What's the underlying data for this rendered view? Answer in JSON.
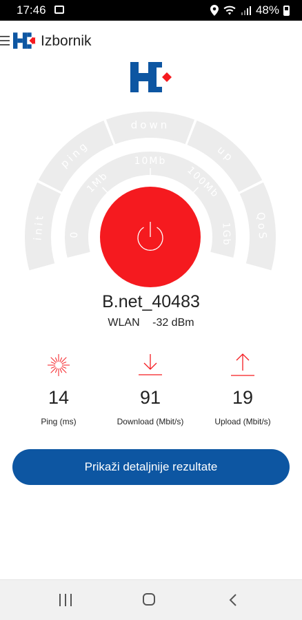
{
  "status_bar": {
    "time": "17:46",
    "battery": "48%"
  },
  "header": {
    "title": "Izbornik"
  },
  "gauge": {
    "outer_labels": [
      "init",
      "ping",
      "down",
      "up",
      "QoS"
    ],
    "inner_labels": [
      "0",
      "1Mb",
      "10Mb",
      "100Mb",
      "1Gb"
    ]
  },
  "network": {
    "name": "B.net_40483",
    "type": "WLAN",
    "signal": "-32 dBm"
  },
  "results": {
    "ping": {
      "value": "14",
      "label": "Ping  (ms)"
    },
    "download": {
      "value": "91",
      "label": "Download  (Mbit/s)"
    },
    "upload": {
      "value": "19",
      "label": "Upload  (Mbit/s)"
    }
  },
  "details_button": {
    "label": "Prikaži detaljnije rezultate"
  },
  "colors": {
    "accent_red": "#f51a1f",
    "brand_blue": "#0d56a2",
    "gauge_gray": "#ececec"
  }
}
